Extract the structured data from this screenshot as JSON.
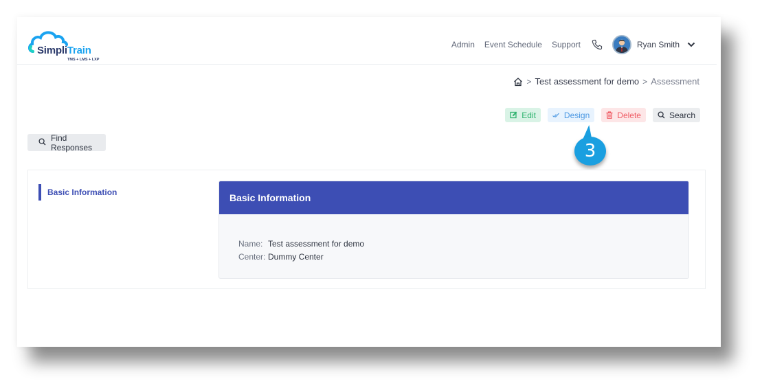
{
  "brand": {
    "name_part1": "Simpli",
    "name_part2": "Train",
    "tagline": "TMS + LMS + LXP",
    "colors": {
      "primary": "#3d4eb4",
      "logo_blue": "#1aa3f0",
      "logo_navy": "#2b3a6b"
    }
  },
  "topnav": {
    "links": [
      "Admin",
      "Event Schedule",
      "Support"
    ],
    "phone_icon": "phone-icon",
    "user": {
      "name": "Ryan Smith",
      "avatar_icon": "user-avatar",
      "menu_icon": "chevron-down-icon"
    }
  },
  "breadcrumb": {
    "home_icon": "home-icon",
    "items": [
      "Test assessment for demo",
      "Assessment"
    ],
    "separator": ">"
  },
  "actions": {
    "edit": {
      "label": "Edit",
      "icon": "edit-icon",
      "color": "#2fb36f"
    },
    "design": {
      "label": "Design",
      "icon": "check-double-icon",
      "color": "#4a97e2"
    },
    "delete": {
      "label": "Delete",
      "icon": "trash-icon",
      "color": "#ef5a63"
    },
    "search": {
      "label": "Search",
      "icon": "search-icon"
    }
  },
  "callout": {
    "step": "3",
    "color": "#1a9fe0"
  },
  "find_responses": {
    "label": "Find Responses",
    "icon": "search-icon"
  },
  "sidebar": {
    "items": [
      {
        "label": "Basic Information",
        "active": true
      }
    ]
  },
  "panel": {
    "title": "Basic Information",
    "fields": [
      {
        "label": "Name:",
        "value": "Test assessment for demo"
      },
      {
        "label": "Center:",
        "value": "Dummy Center"
      }
    ]
  }
}
